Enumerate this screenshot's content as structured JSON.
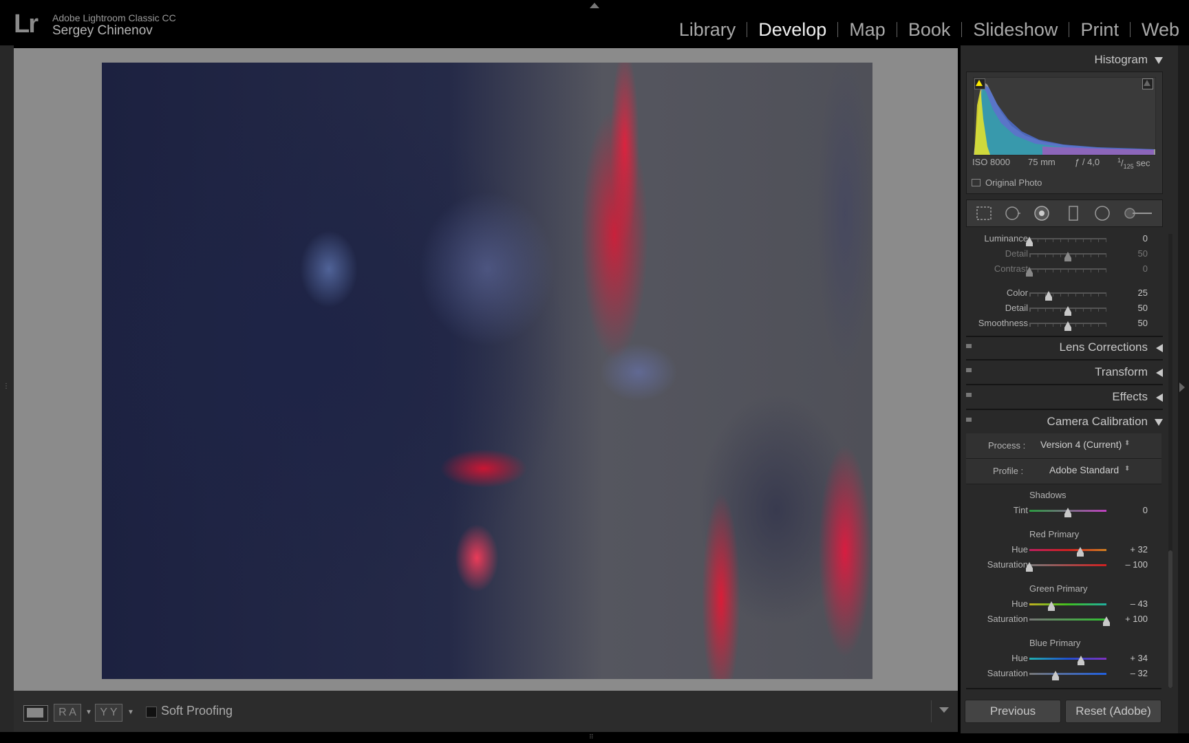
{
  "app": {
    "logo": "Lr",
    "name": "Adobe Lightroom Classic CC",
    "user": "Sergey Chinenov"
  },
  "modules": [
    {
      "label": "Library",
      "active": false
    },
    {
      "label": "Develop",
      "active": true
    },
    {
      "label": "Map",
      "active": false
    },
    {
      "label": "Book",
      "active": false
    },
    {
      "label": "Slideshow",
      "active": false
    },
    {
      "label": "Print",
      "active": false
    },
    {
      "label": "Web",
      "active": false
    }
  ],
  "histogram": {
    "title": "Histogram",
    "iso": "ISO 8000",
    "focal": "75 mm",
    "aperture": "ƒ / 4,0",
    "shutter_num": "1",
    "shutter_den": "125",
    "shutter_unit": " sec",
    "original_photo": "Original Photo"
  },
  "tools": [
    "crop-overlay-icon",
    "spot-removal-icon",
    "red-eye-icon",
    "graduated-filter-icon",
    "radial-filter-icon",
    "adjustment-brush-icon"
  ],
  "noise_reduction": {
    "luminance": {
      "label": "Luminance",
      "value": "0",
      "level": 0
    },
    "lum_detail": {
      "label": "Detail",
      "value": "50",
      "level": 0.5
    },
    "lum_contrast": {
      "label": "Contrast",
      "value": "0",
      "level": 0
    },
    "color": {
      "label": "Color",
      "value": "25",
      "level": 0.25
    },
    "color_detail": {
      "label": "Detail",
      "value": "50",
      "level": 0.5
    },
    "smoothness": {
      "label": "Smoothness",
      "value": "50",
      "level": 0.5
    }
  },
  "collapsed_panels": [
    "Lens Corrections",
    "Transform",
    "Effects"
  ],
  "calibration": {
    "title": "Camera Calibration",
    "process_label": "Process :",
    "process_value": "Version 4 (Current)",
    "profile_label": "Profile :",
    "profile_value": "Adobe Standard",
    "shadows": {
      "title": "Shadows",
      "tint_label": "Tint",
      "tint_value": "0",
      "tint_level": 0.5
    },
    "red": {
      "title": "Red Primary",
      "hue_label": "Hue",
      "hue_value": "+ 32",
      "hue_level": 0.66,
      "sat_label": "Saturation",
      "sat_value": "– 100",
      "sat_level": 0
    },
    "green": {
      "title": "Green Primary",
      "hue_label": "Hue",
      "hue_value": "– 43",
      "hue_level": 0.285,
      "sat_label": "Saturation",
      "sat_value": "+ 100",
      "sat_level": 1
    },
    "blue": {
      "title": "Blue Primary",
      "hue_label": "Hue",
      "hue_value": "+ 34",
      "hue_level": 0.67,
      "sat_label": "Saturation",
      "sat_value": "– 32",
      "sat_level": 0.34
    }
  },
  "toolbar": {
    "soft_proofing": "Soft Proofing",
    "ra_label": "R A",
    "yy_label": "Y Y"
  },
  "buttons": {
    "previous": "Previous",
    "reset": "Reset (Adobe)"
  },
  "colors": {
    "accent_clip": "#ffeb00",
    "panel_bg": "#292929",
    "canvas_bg": "#8b8b8b"
  }
}
